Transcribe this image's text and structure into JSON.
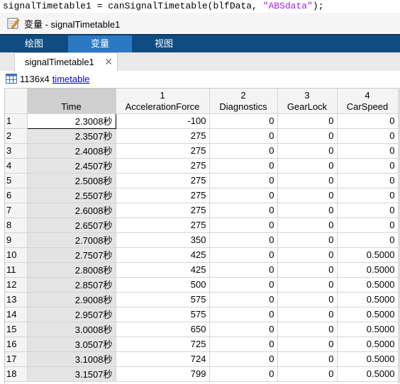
{
  "command": {
    "prefix": "signalTimetable1 = canSignalTimetable(blfData, ",
    "string_arg": "\"ABSdata\"",
    "suffix": ");"
  },
  "window": {
    "icon": "variable-editor-icon",
    "title": "变量 - signalTimetable1"
  },
  "ribbon": {
    "tabs": [
      {
        "label": "绘图",
        "active": false
      },
      {
        "label": "变量",
        "active": true
      },
      {
        "label": "视图",
        "active": false
      }
    ]
  },
  "doc_tab": {
    "label": "signalTimetable1",
    "close_icon": "close-icon"
  },
  "info": {
    "icon": "table-icon",
    "size": "1136x4",
    "type_link": "timetable"
  },
  "table": {
    "columns": [
      {
        "index": "",
        "name": "Time"
      },
      {
        "index": "1",
        "name": "AccelerationForce"
      },
      {
        "index": "2",
        "name": "Diagnostics"
      },
      {
        "index": "3",
        "name": "GearLock"
      },
      {
        "index": "4",
        "name": "CarSpeed"
      }
    ],
    "rows": [
      {
        "n": "1",
        "time": "2.3008秒",
        "acc": "-100",
        "diag": "0",
        "gear": "0",
        "speed": "0"
      },
      {
        "n": "2",
        "time": "2.3507秒",
        "acc": "275",
        "diag": "0",
        "gear": "0",
        "speed": "0"
      },
      {
        "n": "3",
        "time": "2.4008秒",
        "acc": "275",
        "diag": "0",
        "gear": "0",
        "speed": "0"
      },
      {
        "n": "4",
        "time": "2.4507秒",
        "acc": "275",
        "diag": "0",
        "gear": "0",
        "speed": "0"
      },
      {
        "n": "5",
        "time": "2.5008秒",
        "acc": "275",
        "diag": "0",
        "gear": "0",
        "speed": "0"
      },
      {
        "n": "6",
        "time": "2.5507秒",
        "acc": "275",
        "diag": "0",
        "gear": "0",
        "speed": "0"
      },
      {
        "n": "7",
        "time": "2.6008秒",
        "acc": "275",
        "diag": "0",
        "gear": "0",
        "speed": "0"
      },
      {
        "n": "8",
        "time": "2.6507秒",
        "acc": "275",
        "diag": "0",
        "gear": "0",
        "speed": "0"
      },
      {
        "n": "9",
        "time": "2.7008秒",
        "acc": "350",
        "diag": "0",
        "gear": "0",
        "speed": "0"
      },
      {
        "n": "10",
        "time": "2.7507秒",
        "acc": "425",
        "diag": "0",
        "gear": "0",
        "speed": "0.5000"
      },
      {
        "n": "11",
        "time": "2.8008秒",
        "acc": "425",
        "diag": "0",
        "gear": "0",
        "speed": "0.5000"
      },
      {
        "n": "12",
        "time": "2.8507秒",
        "acc": "500",
        "diag": "0",
        "gear": "0",
        "speed": "0.5000"
      },
      {
        "n": "13",
        "time": "2.9008秒",
        "acc": "575",
        "diag": "0",
        "gear": "0",
        "speed": "0.5000"
      },
      {
        "n": "14",
        "time": "2.9507秒",
        "acc": "575",
        "diag": "0",
        "gear": "0",
        "speed": "0.5000"
      },
      {
        "n": "15",
        "time": "3.0008秒",
        "acc": "650",
        "diag": "0",
        "gear": "0",
        "speed": "0.5000"
      },
      {
        "n": "16",
        "time": "3.0507秒",
        "acc": "725",
        "diag": "0",
        "gear": "0",
        "speed": "0.5000"
      },
      {
        "n": "17",
        "time": "3.1008秒",
        "acc": "724",
        "diag": "0",
        "gear": "0",
        "speed": "0.5000"
      },
      {
        "n": "18",
        "time": "3.1507秒",
        "acc": "799",
        "diag": "0",
        "gear": "0",
        "speed": "0.5000"
      }
    ]
  }
}
